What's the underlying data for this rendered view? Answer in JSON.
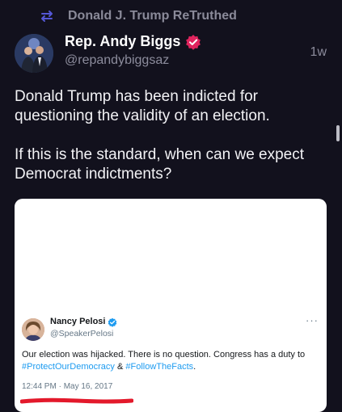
{
  "retruth": {
    "icon": "retruth-icon",
    "label": "Donald J. Trump ReTruthed"
  },
  "post": {
    "author_name": "Rep. Andy Biggs",
    "author_handle": "@repandybiggsaz",
    "time": "1w",
    "verified_icon": "verified-badge-icon",
    "verified_color": "#e0245e",
    "paragraphs": [
      "Donald Trump has been indicted for questioning the validity of an election.",
      "If this is the standard, when can we expect Democrat indictments?"
    ]
  },
  "embedded_tweet": {
    "author_name": "Nancy Pelosi",
    "author_handle": "@SpeakerPelosi",
    "verified_color": "#1d9bf0",
    "more_icon": "more-options-icon",
    "text_prefix": "Our election was hijacked. There is no question. Congress has a duty to",
    "hashtag_1": "#ProtectOurDemocracy",
    "joiner": " & ",
    "hashtag_2": "#FollowTheFacts",
    "text_suffix": ".",
    "timestamp": "12:44 PM · May 16, 2017",
    "annotation_color": "#e3192b"
  },
  "theme": {
    "background": "#12111d",
    "muted": "#8c8c9c"
  }
}
